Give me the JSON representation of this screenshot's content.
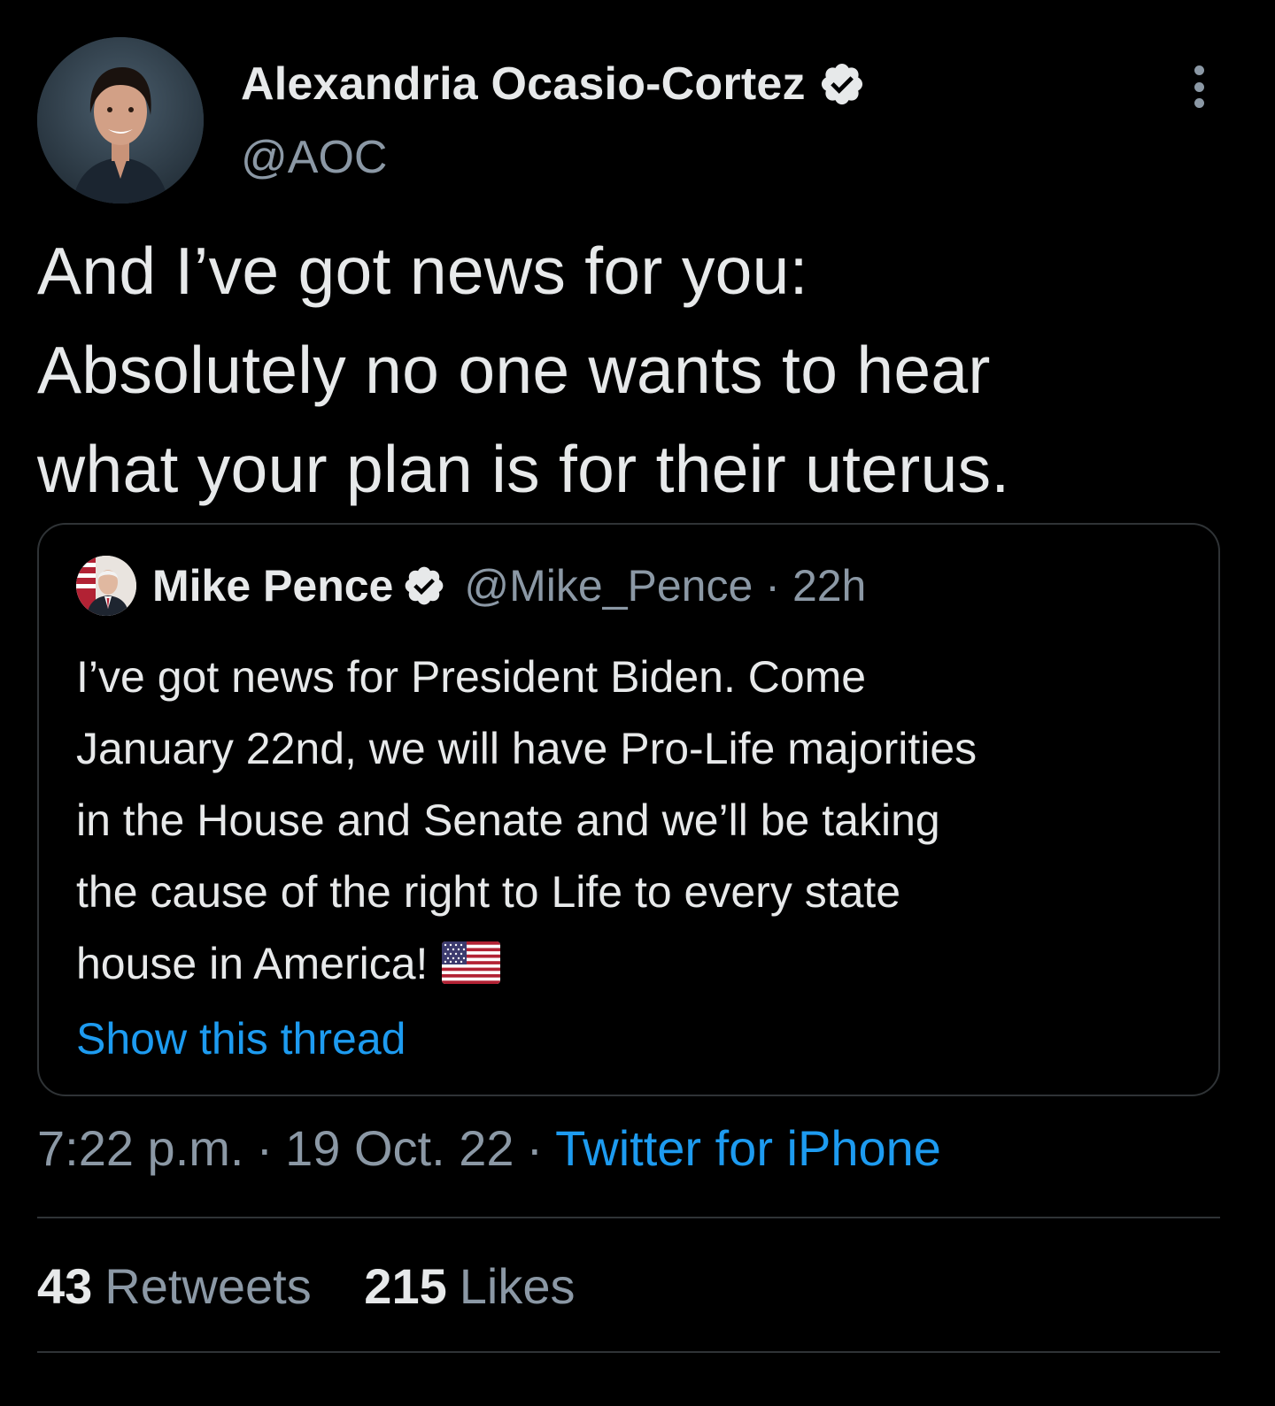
{
  "tweet": {
    "author": {
      "display_name": "Alexandria Ocasio-Cortez",
      "handle": "@AOC",
      "verified_icon": "verified-badge-icon"
    },
    "text_lines": [
      "And I’ve got news for you:",
      "Absolutely no one wants to hear",
      "what your plan is for their uterus."
    ],
    "more_icon": "more-vertical-icon",
    "quoted": {
      "display_name": "Mike Pence",
      "handle": "@Mike_Pence",
      "separator": "·",
      "time_ago": "22h",
      "text_lines": [
        "I’ve got news for President Biden. Come",
        "January 22nd, we will have Pro-Life majorities",
        "in the House and Senate and we’ll be taking",
        "the cause of the right to Life to every state",
        "house in America!"
      ],
      "emoji": "us-flag-icon",
      "show_thread": "Show this thread"
    },
    "meta": {
      "time": "7:22 p.m.",
      "separator": "·",
      "date": "19 Oct. 22",
      "source": "Twitter for iPhone"
    },
    "stats": {
      "retweets_count": "43",
      "retweets_label": "Retweets",
      "likes_count": "215",
      "likes_label": "Likes"
    },
    "colors": {
      "background": "#000000",
      "text": "#e7e9ea",
      "muted": "#8b98a5",
      "link": "#1d9bf0",
      "border": "#2f3336"
    }
  }
}
